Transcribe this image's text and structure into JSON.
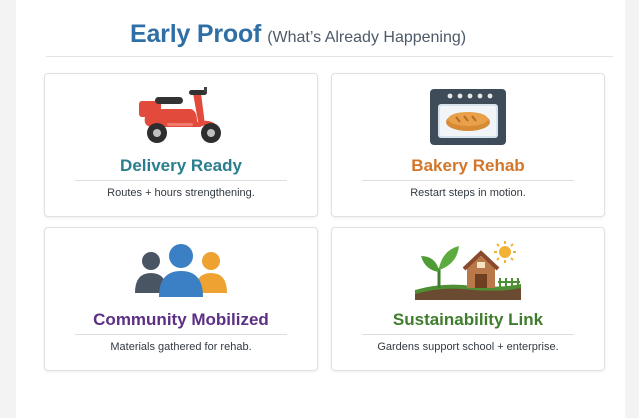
{
  "header": {
    "title": "Early Proof",
    "subtitle": "(What’s Already Happening)"
  },
  "cards": [
    {
      "title": "Delivery Ready",
      "description": "Routes + hours strengthening.",
      "icon": "scooter-icon",
      "title_color": "#2a7e8e"
    },
    {
      "title": "Bakery Rehab",
      "description": "Restart steps in motion.",
      "icon": "oven-icon",
      "title_color": "#d2762a"
    },
    {
      "title": "Community Mobilized",
      "description": "Materials gathered for rehab.",
      "icon": "people-icon",
      "title_color": "#5c2f84"
    },
    {
      "title": "Sustainability Link",
      "description": "Gardens support school + enterprise.",
      "icon": "garden-farm-icon",
      "title_color": "#3f7d2c"
    }
  ]
}
